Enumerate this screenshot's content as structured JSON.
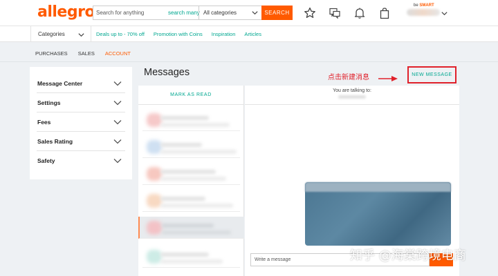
{
  "header": {
    "logo": "allegro",
    "search_placeholder": "Search for anything",
    "search_scope": "search many",
    "category_select": "All categories",
    "search_button": "SEARCH",
    "besmart_prefix": "be",
    "besmart_brand": "SMART",
    "icons": [
      "star-icon",
      "chat-icon",
      "bell-icon",
      "bag-icon"
    ]
  },
  "subnav": {
    "categories": "Categories",
    "links": [
      "Deals up to - 70% off",
      "Promotion with Coins",
      "Inspiration",
      "Articles"
    ]
  },
  "tabs": [
    {
      "label": "PURCHASES",
      "active": false
    },
    {
      "label": "SALES",
      "active": false
    },
    {
      "label": "ACCOUNT",
      "active": true
    }
  ],
  "sidebar": {
    "items": [
      "Message Center",
      "Settings",
      "Fees",
      "Sales Rating",
      "Safety"
    ]
  },
  "messages": {
    "title": "Messages",
    "annotation": "点击新建消息",
    "new_message": "NEW MESSAGE",
    "mark_as_read": "MARK AS READ",
    "talking_to": "You are talking to:",
    "compose_placeholder": "Write a message"
  },
  "watermark": "知乎 @海棠跨境电商",
  "colors": {
    "brand": "#ff5a00",
    "link": "#00a790",
    "annotation": "#e0202a"
  }
}
